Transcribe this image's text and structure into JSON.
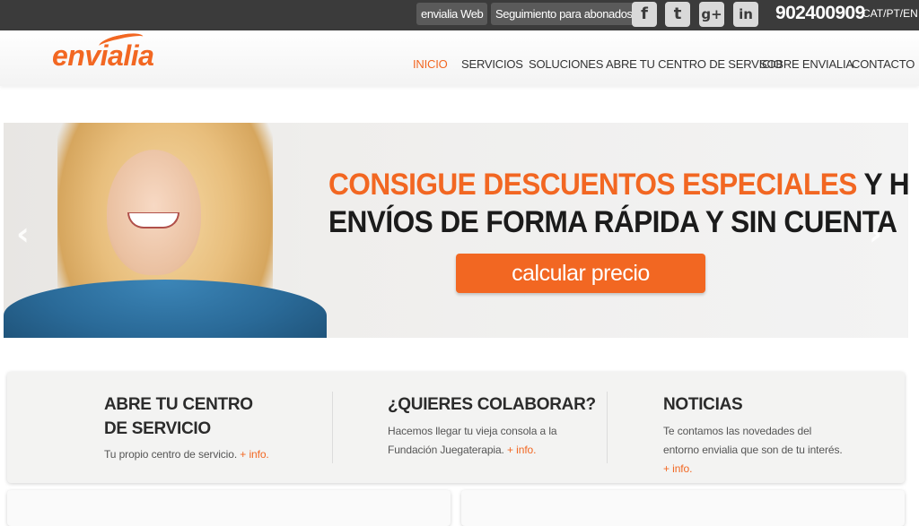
{
  "topbar": {
    "web_label": "envialia Web",
    "tracking_label": "Seguimiento para abonados",
    "social": [
      {
        "name": "facebook-icon",
        "glyph": "f"
      },
      {
        "name": "twitter-icon",
        "glyph": "t"
      },
      {
        "name": "google-plus-icon",
        "glyph": "g+"
      },
      {
        "name": "linkedin-icon",
        "glyph": "in"
      }
    ],
    "phone": "902400909",
    "languages": "CAT/PT/EN"
  },
  "header": {
    "logo": "envialia",
    "nav": [
      {
        "label": "INICIO",
        "active": true
      },
      {
        "label": "SERVICIOS",
        "active": false
      },
      {
        "label": "SOLUCIONES",
        "active": false
      },
      {
        "label": "ABRE TU CENTRO DE SERVICIO",
        "active": false
      },
      {
        "label": "SOBRE ENVIALIA",
        "active": false
      },
      {
        "label": "CONTACTO",
        "active": false
      }
    ]
  },
  "hero": {
    "headline_orange": "CONSIGUE DESCUENTOS ESPECIALES",
    "headline_dark_1": " Y HAZ",
    "headline_dark_2": "ENVÍOS DE FORMA RÁPIDA Y SIN CUENTA",
    "cta_label": "calcular precio",
    "prev_arrow": "‹",
    "next_arrow": "›"
  },
  "cards": [
    {
      "title": "ABRE TU CENTRO DE SERVICIO",
      "text": "Tu propio centro de servicio.",
      "more": "+ info."
    },
    {
      "title": "¿QUIERES COLABORAR?",
      "text": "Hacemos llegar tu vieja consola a la Fundación Juegaterapia.",
      "more": "+ info."
    },
    {
      "title": "NOTICIAS",
      "text": "Te contamos las novedades del entorno envialia que son de tu interés.",
      "more": "+ info."
    }
  ],
  "colors": {
    "brand_orange": "#f26722",
    "topbar_bg": "#3b3b3b"
  }
}
